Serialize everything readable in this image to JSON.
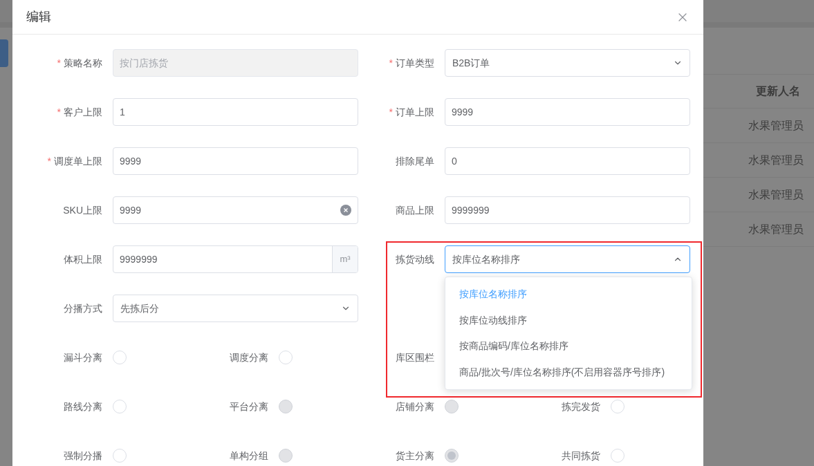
{
  "background_table": {
    "header": "更新人名",
    "cells": [
      "水果管理员",
      "水果管理员",
      "水果管理员",
      "水果管理员"
    ]
  },
  "dialog": {
    "title": "编辑"
  },
  "field_rows": [
    [
      {
        "label": "策略名称",
        "required_mark": "*",
        "kind": "input",
        "value": "按门店拣货",
        "disabled": true
      },
      {
        "label": "订单类型",
        "required_mark": "*",
        "kind": "select",
        "value": "B2B订单",
        "open": false
      }
    ],
    [
      {
        "label": "客户上限",
        "required_mark": "*",
        "kind": "input",
        "value": "1",
        "disabled": false
      },
      {
        "label": "订单上限",
        "required_mark": "*",
        "kind": "input",
        "value": "9999",
        "disabled": false
      }
    ],
    [
      {
        "label": "调度单上限",
        "required_mark": "*",
        "kind": "input",
        "value": "9999",
        "disabled": false
      },
      {
        "label": "排除尾单",
        "kind": "input",
        "value": "0",
        "disabled": false
      }
    ],
    [
      {
        "label": "SKU上限",
        "kind": "clearable",
        "value": "9999"
      },
      {
        "label": "商品上限",
        "kind": "input",
        "value": "9999999",
        "disabled": false
      }
    ],
    [
      {
        "label": "体积上限",
        "kind": "unit",
        "value": "9999999",
        "unit": "m³"
      },
      {
        "label": "拣货动线",
        "kind": "select",
        "value": "按库位名称排序",
        "open": true,
        "highlighted": true,
        "options": [
          {
            "label": "按库位名称排序",
            "selected": true
          },
          {
            "label": "按库位动线排序",
            "selected": false
          },
          {
            "label": "按商品编码/库位名称排序",
            "selected": false
          },
          {
            "label": "商品/批次号/库位名称排序(不启用容器序号排序)",
            "selected": false
          }
        ]
      }
    ],
    [
      {
        "label": "分播方式",
        "kind": "select",
        "value": "先拣后分",
        "open": false
      }
    ]
  ],
  "switch_rows": [
    [
      {
        "label": "漏斗分离",
        "kind": "radio",
        "checked": false,
        "disabled": false
      },
      {
        "label": "调度分离",
        "kind": "radio",
        "checked": false,
        "disabled": false
      },
      {
        "label": "库区围栏",
        "kind": "covered"
      }
    ],
    [
      {
        "label": "路线分离",
        "kind": "radio",
        "checked": false,
        "disabled": false
      },
      {
        "label": "平台分离",
        "kind": "radio",
        "checked": false,
        "disabled": true
      },
      {
        "label": "店铺分离",
        "kind": "radio",
        "checked": false,
        "disabled": true
      },
      {
        "label": "拣完发货",
        "kind": "radio",
        "checked": false,
        "disabled": false
      }
    ],
    [
      {
        "label": "强制分播",
        "kind": "radio",
        "checked": false,
        "disabled": false
      },
      {
        "label": "单构分组",
        "kind": "radio",
        "checked": false,
        "disabled": true
      },
      {
        "label": "货主分离",
        "kind": "radio",
        "checked": true,
        "disabled": true
      },
      {
        "label": "共同拣货",
        "kind": "radio",
        "checked": false,
        "disabled": false
      }
    ]
  ]
}
